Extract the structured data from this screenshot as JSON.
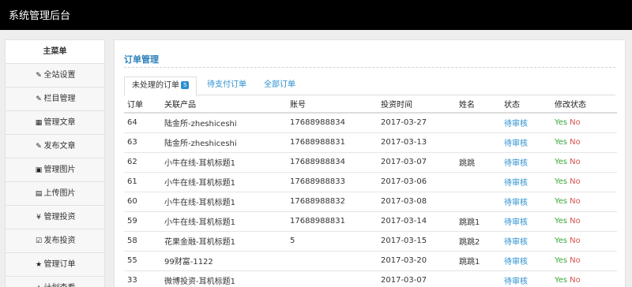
{
  "header": {
    "title": "系统管理后台"
  },
  "sidebar": {
    "title": "主菜单",
    "items": [
      {
        "icon": "edit-icon",
        "glyph": "✎",
        "label": "全站设置"
      },
      {
        "icon": "edit-icon",
        "glyph": "✎",
        "label": "栏目管理"
      },
      {
        "icon": "grid-icon",
        "glyph": "▦",
        "label": "管理文章"
      },
      {
        "icon": "edit-icon",
        "glyph": "✎",
        "label": "发布文章"
      },
      {
        "icon": "image-icon",
        "glyph": "▣",
        "label": "管理图片"
      },
      {
        "icon": "upload-image-icon",
        "glyph": "▤",
        "label": "上传图片"
      },
      {
        "icon": "yen-icon",
        "glyph": "¥",
        "label": "管理投资"
      },
      {
        "icon": "check-square-icon",
        "glyph": "☑",
        "label": "发布投资"
      },
      {
        "icon": "star-icon",
        "glyph": "★",
        "label": "管理订单"
      },
      {
        "icon": "star-icon",
        "glyph": "★",
        "label": "计划查看"
      }
    ]
  },
  "main": {
    "title": "订单管理",
    "tabs": [
      {
        "label": "未处理的订单",
        "badge": "5"
      },
      {
        "label": "待支付订单"
      },
      {
        "label": "全部订单"
      }
    ],
    "columns": [
      "订单",
      "关联产品",
      "账号",
      "投资时间",
      "姓名",
      "状态",
      "修改状态"
    ],
    "yes_label": "Yes",
    "no_label": "No",
    "rows": [
      {
        "id": "64",
        "product": "陆金所-zheshiceshi",
        "account": "17688988834",
        "time": "2017-03-27",
        "name": "",
        "status": "待审核"
      },
      {
        "id": "63",
        "product": "陆金所-zheshiceshi",
        "account": "17688988831",
        "time": "2017-03-13",
        "name": "",
        "status": "待审核"
      },
      {
        "id": "62",
        "product": "小牛在线-耳机标题1",
        "account": "17688988834",
        "time": "2017-03-07",
        "name": "跳跳",
        "status": "待审核"
      },
      {
        "id": "61",
        "product": "小牛在线-耳机标题1",
        "account": "17688988833",
        "time": "2017-03-06",
        "name": "",
        "status": "待审核"
      },
      {
        "id": "60",
        "product": "小牛在线-耳机标题1",
        "account": "17688988832",
        "time": "2017-03-08",
        "name": "",
        "status": "待审核"
      },
      {
        "id": "59",
        "product": "小牛在线-耳机标题1",
        "account": "17688988831",
        "time": "2017-03-14",
        "name": "跳跳1",
        "status": "待审核"
      },
      {
        "id": "58",
        "product": "花果金融-耳机标题1",
        "account": "5",
        "time": "2017-03-15",
        "name": "跳跳2",
        "status": "待审核"
      },
      {
        "id": "55",
        "product": "99财富-1122",
        "account": "",
        "time": "2017-03-20",
        "name": "跳跳1",
        "status": "待审核"
      },
      {
        "id": "33",
        "product": "微博投资-耳机标题1",
        "account": "",
        "time": "2017-03-07",
        "name": "",
        "status": "待审核"
      }
    ]
  }
}
